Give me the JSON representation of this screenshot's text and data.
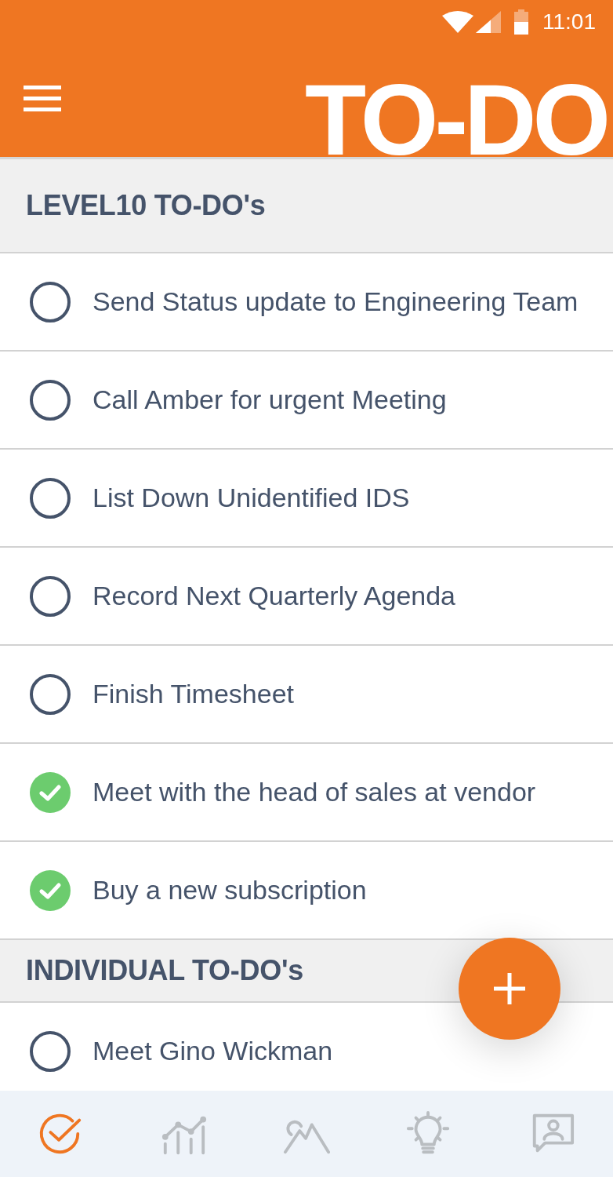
{
  "status_bar": {
    "time": "11:01"
  },
  "app_bar": {
    "title": "TO-DO"
  },
  "sections": [
    {
      "title": "LEVEL10 TO-DO's",
      "items": [
        {
          "label": "Send Status update to Engineering Team",
          "checked": false
        },
        {
          "label": "Call Amber for urgent Meeting",
          "checked": false
        },
        {
          "label": "List Down Unidentified IDS",
          "checked": false
        },
        {
          "label": "Record Next Quarterly Agenda",
          "checked": false
        },
        {
          "label": "Finish Timesheet",
          "checked": false
        },
        {
          "label": "Meet with the head of sales at vendor",
          "checked": true
        },
        {
          "label": "Buy a new subscription",
          "checked": true
        }
      ]
    },
    {
      "title": "INDIVIDUAL TO-DO's",
      "items": [
        {
          "label": "Meet Gino Wickman",
          "checked": false
        }
      ]
    }
  ],
  "bottom_nav": {
    "items": [
      {
        "kind": "tasks",
        "selected": true
      },
      {
        "kind": "metrics",
        "selected": false
      },
      {
        "kind": "goals",
        "selected": false
      },
      {
        "kind": "ideas",
        "selected": false
      },
      {
        "kind": "people",
        "selected": false
      }
    ]
  }
}
